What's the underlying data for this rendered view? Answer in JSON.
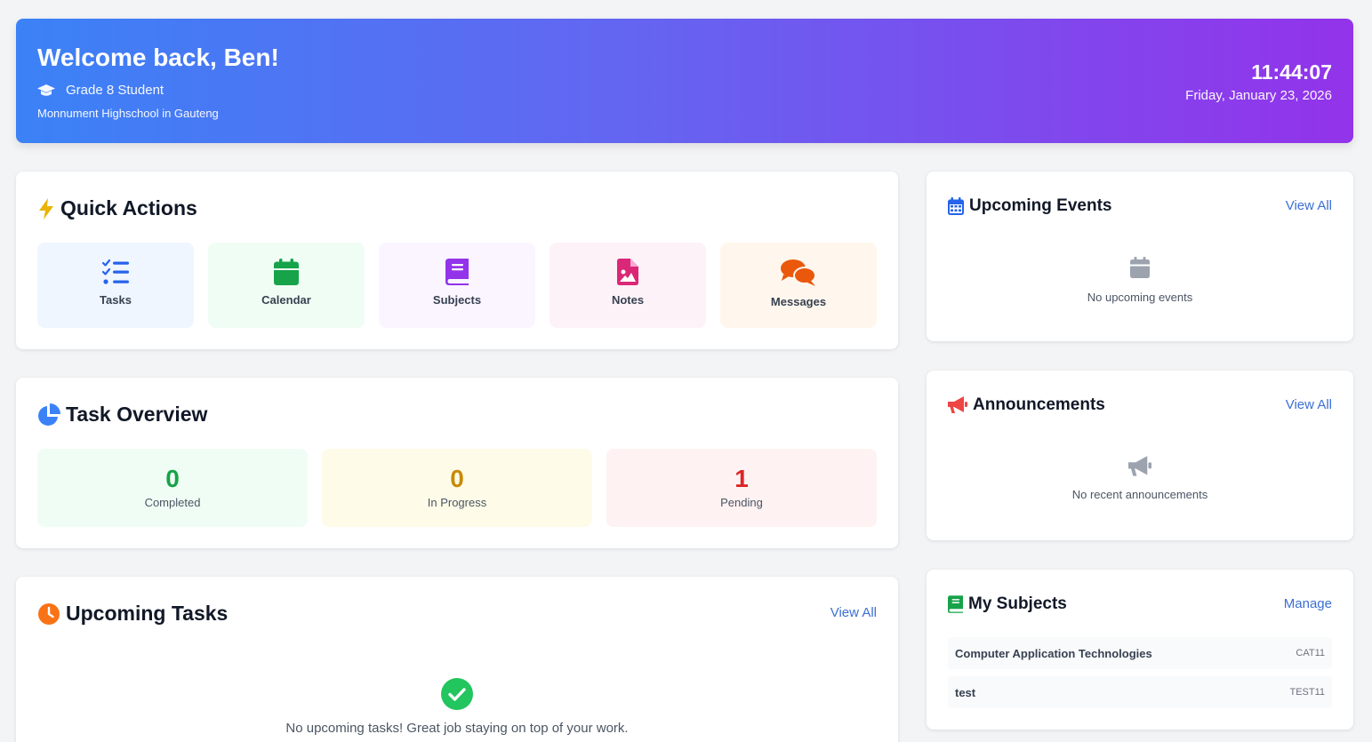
{
  "header": {
    "welcome": "Welcome back, Ben!",
    "grade": "Grade 8 Student",
    "school": "Monnument Highschool in Gauteng",
    "time": "11:44:07",
    "date": "Friday, January 23, 2026"
  },
  "quick_actions": {
    "title": "Quick Actions",
    "items": [
      {
        "label": "Tasks",
        "icon": "list-check-icon",
        "color": "#2563eb",
        "bg": "#eff6ff"
      },
      {
        "label": "Calendar",
        "icon": "calendar-icon",
        "color": "#16a34a",
        "bg": "#f0fdf4"
      },
      {
        "label": "Subjects",
        "icon": "book-icon",
        "color": "#9333ea",
        "bg": "#faf5ff"
      },
      {
        "label": "Notes",
        "icon": "file-image-icon",
        "color": "#db2777",
        "bg": "#fdf2f8"
      },
      {
        "label": "Messages",
        "icon": "comments-icon",
        "color": "#ea580c",
        "bg": "#fff7ed"
      }
    ]
  },
  "task_overview": {
    "title": "Task Overview",
    "stats": [
      {
        "value": "0",
        "label": "Completed",
        "color": "#16a34a",
        "bg": "#f0fdf4"
      },
      {
        "value": "0",
        "label": "In Progress",
        "color": "#ca8a04",
        "bg": "#fefce8"
      },
      {
        "value": "1",
        "label": "Pending",
        "color": "#dc2626",
        "bg": "#fef2f2"
      }
    ]
  },
  "upcoming_tasks": {
    "title": "Upcoming Tasks",
    "view_all": "View All",
    "empty_text": "No upcoming tasks! Great job staying on top of your work."
  },
  "upcoming_events": {
    "title": "Upcoming Events",
    "view_all": "View All",
    "empty_text": "No upcoming events"
  },
  "announcements": {
    "title": "Announcements",
    "view_all": "View All",
    "empty_text": "No recent announcements"
  },
  "my_subjects": {
    "title": "My Subjects",
    "manage": "Manage",
    "items": [
      {
        "name": "Computer Application Technologies",
        "code": "CAT11"
      },
      {
        "name": "test",
        "code": "TEST11"
      }
    ]
  },
  "colors": {
    "accent_link": "#3b6fd4",
    "hero_start": "#3b82f6",
    "hero_end": "#9333ea"
  }
}
